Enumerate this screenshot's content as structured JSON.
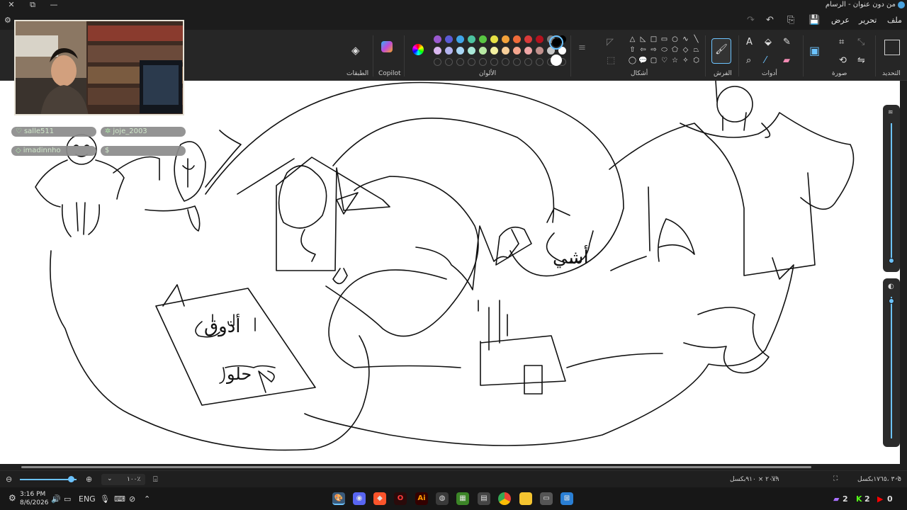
{
  "window": {
    "title": "من دون عنوان - الرسام",
    "minimize": "—",
    "maximize": "⧉",
    "close": "✕"
  },
  "menu": {
    "file": "ملف",
    "edit": "تحرير",
    "view": "عرض"
  },
  "ribbon": {
    "groups": {
      "selection": "التحديد",
      "image": "صورة",
      "tools": "أدوات",
      "brushes": "الفرش",
      "shapes": "أشكال",
      "colors": "الألوان",
      "copilot": "Copilot",
      "layers": "الطبقات"
    },
    "colors_row1": [
      "#9b59d0",
      "#5b5bd6",
      "#3fa5e8",
      "#4cc3a0",
      "#58c742",
      "#e6e044",
      "#f2a13a",
      "#ef6b3a",
      "#d93a3a",
      "#b3121e",
      "#7a7a7a",
      "#000000"
    ],
    "colors_row2": [
      "#d9b7ef",
      "#b4b4f0",
      "#a9d7f5",
      "#a9e7d7",
      "#b7e8a4",
      "#f3f0a1",
      "#f7cf9a",
      "#f5a68f",
      "#f0a7a7",
      "#c2918d",
      "#c8c8c8",
      "#ffffff"
    ],
    "active_color_1": "#000000",
    "active_color_2": "#ffffff"
  },
  "webcam": {
    "chat": [
      {
        "user": "salle511",
        "icon": "heart-icon"
      },
      {
        "user": "joje_2003",
        "icon": "star-icon"
      },
      {
        "user": "imadinnho",
        "icon": "diamond-icon"
      },
      {
        "user": "$",
        "icon": "dollar-icon"
      }
    ]
  },
  "status": {
    "zoom": "١٠٠٪",
    "canvas_size": "٢٠٧٩ × ٩١٠بكسل",
    "cursor_pos": "٣٠٥ ،١٧٦٥بكسل"
  },
  "taskbar": {
    "time": "3:16 PM",
    "date": "8/6/2026",
    "lang": "ENG",
    "badges": [
      {
        "count": "2",
        "color": "#a970ff",
        "icon": "twitch-icon"
      },
      {
        "count": "2",
        "color": "#53fc18",
        "icon": "kick-icon"
      },
      {
        "count": "0",
        "color": "#ff0000",
        "icon": "youtube-icon"
      }
    ]
  },
  "canvas_text": {
    "arabic_1": "أذوق",
    "arabic_2": "حلو",
    "arabic_3": "أشي"
  }
}
